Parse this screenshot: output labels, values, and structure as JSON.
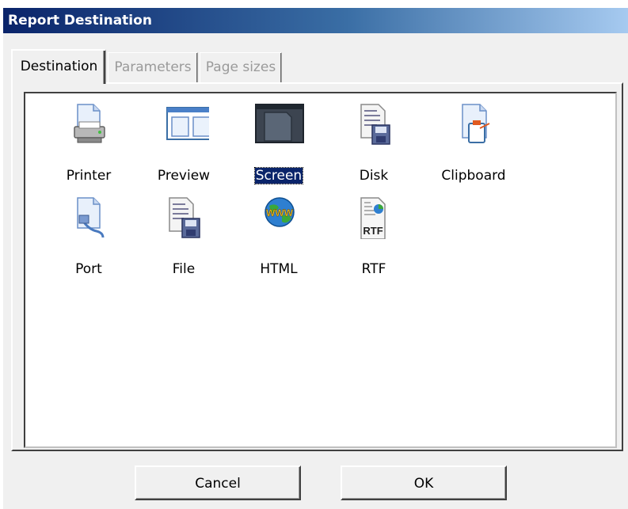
{
  "window": {
    "title": "Report Destination"
  },
  "tabs": [
    {
      "label": "Destination",
      "active": true
    },
    {
      "label": "Parameters",
      "active": false
    },
    {
      "label": "Page sizes",
      "active": false
    }
  ],
  "destinations": [
    {
      "label": "Printer",
      "icon": "printer-icon",
      "selected": false
    },
    {
      "label": "Preview",
      "icon": "preview-icon",
      "selected": false
    },
    {
      "label": "Screen",
      "icon": "screen-icon",
      "selected": true
    },
    {
      "label": "Disk",
      "icon": "disk-icon",
      "selected": false
    },
    {
      "label": "Clipboard",
      "icon": "clipboard-icon",
      "selected": false
    },
    {
      "label": "Port",
      "icon": "port-icon",
      "selected": false
    },
    {
      "label": "File",
      "icon": "file-icon",
      "selected": false
    },
    {
      "label": "HTML",
      "icon": "html-globe-icon",
      "selected": false
    },
    {
      "label": "RTF",
      "icon": "rtf-document-icon",
      "selected": false
    }
  ],
  "rtf_icon_text": "RTF",
  "html_icon_text": "WWW",
  "buttons": {
    "cancel": "Cancel",
    "ok": "OK"
  },
  "colors": {
    "selection": "#0a246a",
    "title_start": "#0a246a",
    "title_end": "#a6caf0"
  }
}
